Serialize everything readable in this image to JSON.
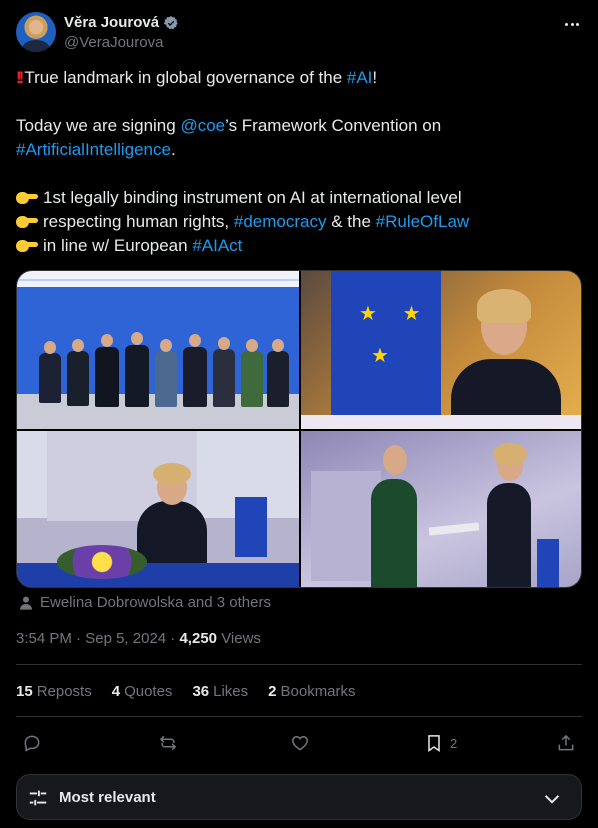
{
  "author": {
    "name": "Věra Jourová",
    "handle": "@VeraJourova"
  },
  "tweet": {
    "line1_pre": "True landmark in global governance of the ",
    "line1_tag": "#AI",
    "line1_post": "!",
    "line2_pre": "Today we are signing ",
    "line2_tag": "@coe",
    "line2_post": "’s Framework Convention on",
    "line3_tag": "#ArtificialIntelligence",
    "line3_post": ".",
    "bullet1": "1st legally binding instrument on AI at international level",
    "bullet2_pre": "respecting human rights, ",
    "bullet2_tag1": "#democracy",
    "bullet2_mid": " & the ",
    "bullet2_tag2": "#RuleOfLaw",
    "bullet3_pre": "in line w/ European ",
    "bullet3_tag": "#AIAct"
  },
  "tagged": "Ewelina Dobrowolska and 3 others",
  "meta": {
    "time": "3:54 PM",
    "date": "Sep 5, 2024",
    "views_count": "4,250",
    "views_label": "Views"
  },
  "stats": {
    "reposts_count": "15",
    "reposts_label": "Reposts",
    "quotes_count": "4",
    "quotes_label": "Quotes",
    "likes_count": "36",
    "likes_label": "Likes",
    "bookmarks_count": "2",
    "bookmarks_label": "Bookmarks"
  },
  "actions": {
    "bookmark_count": "2"
  },
  "sort": {
    "label": "Most relevant"
  },
  "colors": {
    "accent": "#1d9bf0",
    "background": "#000000",
    "secondary_text": "#71767b"
  }
}
